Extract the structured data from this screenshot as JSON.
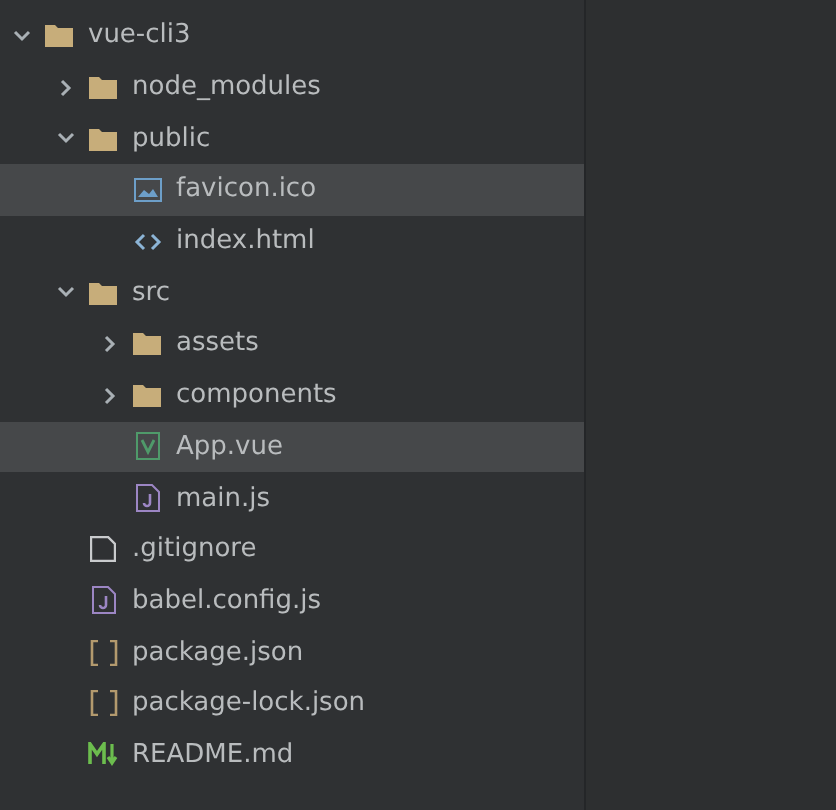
{
  "tree": [
    {
      "name": "vue-cli3",
      "kind": "folder",
      "expanded": true,
      "selected": false,
      "children": [
        {
          "name": "node_modules",
          "kind": "folder",
          "expanded": false,
          "selected": false
        },
        {
          "name": "public",
          "kind": "folder",
          "expanded": true,
          "selected": false,
          "children": [
            {
              "name": "favicon.ico",
              "kind": "image",
              "selected": true
            },
            {
              "name": "index.html",
              "kind": "html",
              "selected": false
            }
          ]
        },
        {
          "name": "src",
          "kind": "folder",
          "expanded": true,
          "selected": false,
          "children": [
            {
              "name": "assets",
              "kind": "folder",
              "expanded": false,
              "selected": false
            },
            {
              "name": "components",
              "kind": "folder",
              "expanded": false,
              "selected": false
            },
            {
              "name": "App.vue",
              "kind": "vue",
              "selected": true
            },
            {
              "name": "main.js",
              "kind": "js",
              "selected": false
            }
          ]
        },
        {
          "name": ".gitignore",
          "kind": "text",
          "selected": false
        },
        {
          "name": "babel.config.js",
          "kind": "js",
          "selected": false
        },
        {
          "name": "package.json",
          "kind": "json",
          "selected": false
        },
        {
          "name": "package-lock.json",
          "kind": "json",
          "selected": false
        },
        {
          "name": "README.md",
          "kind": "markdown",
          "selected": false
        }
      ]
    }
  ]
}
